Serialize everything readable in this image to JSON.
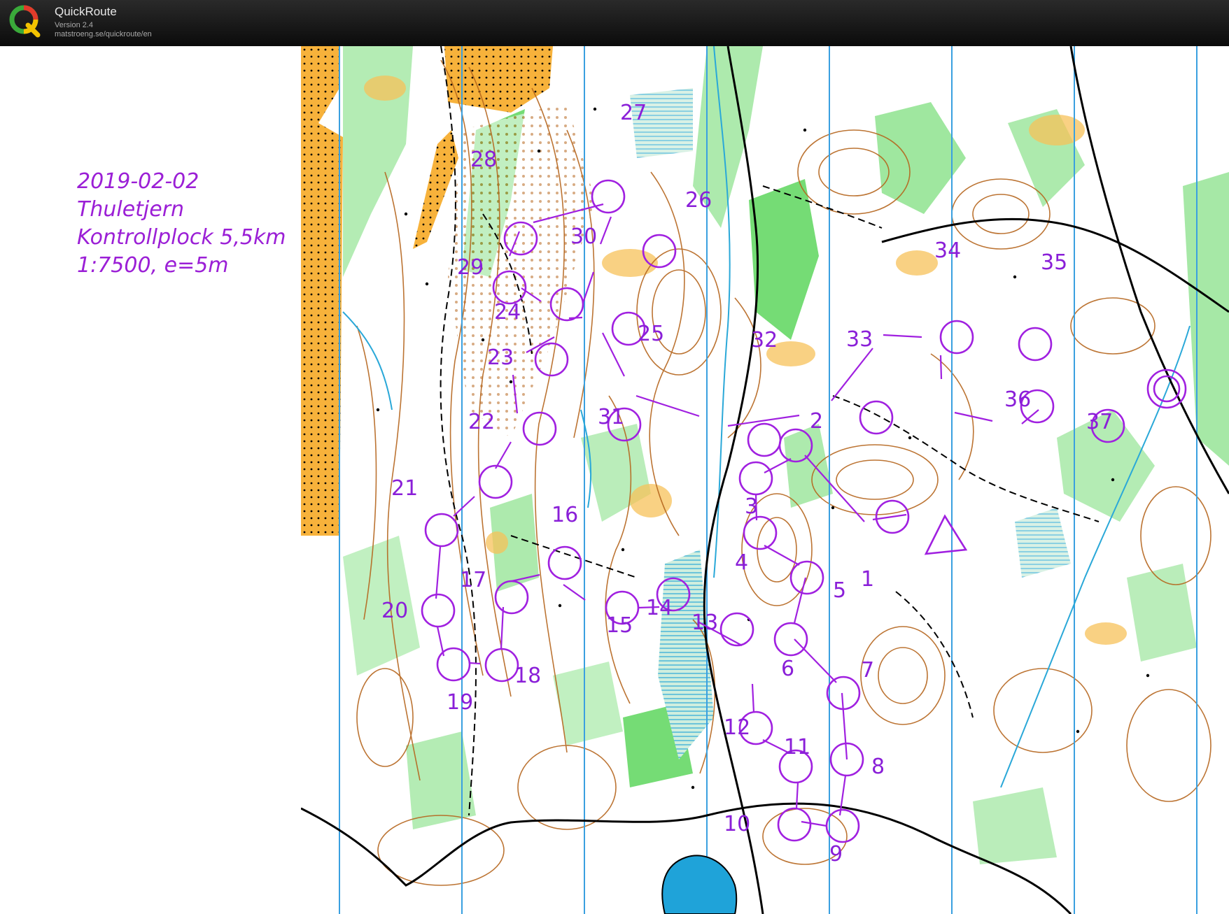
{
  "app": {
    "name": "QuickRoute",
    "version": "Version 2.4",
    "url": "matstroeng.se/quickroute/en"
  },
  "event": {
    "date": "2019-02-02",
    "place": "Thuletjern",
    "course": "Kontrollplock 5,5km",
    "scale": "1:7500, e=5m"
  },
  "colors": {
    "course": "#a020e0",
    "forest": "#ffffff",
    "green": "#5dd65d",
    "open": "#f7b23b",
    "contour": "#b5651d",
    "water": "#2aa8d8",
    "magnetic_north": "#3aa0e0"
  },
  "controls": [
    {
      "label": "1"
    },
    {
      "label": "2"
    },
    {
      "label": "3"
    },
    {
      "label": "4"
    },
    {
      "label": "5"
    },
    {
      "label": "6"
    },
    {
      "label": "7"
    },
    {
      "label": "8"
    },
    {
      "label": "9"
    },
    {
      "label": "10"
    },
    {
      "label": "11"
    },
    {
      "label": "12"
    },
    {
      "label": "13"
    },
    {
      "label": "14"
    },
    {
      "label": "15"
    },
    {
      "label": "16"
    },
    {
      "label": "17"
    },
    {
      "label": "18"
    },
    {
      "label": "19"
    },
    {
      "label": "20"
    },
    {
      "label": "21"
    },
    {
      "label": "22"
    },
    {
      "label": "23"
    },
    {
      "label": "24"
    },
    {
      "label": "25"
    },
    {
      "label": "26"
    },
    {
      "label": "27"
    },
    {
      "label": "28"
    },
    {
      "label": "29"
    },
    {
      "label": "30"
    },
    {
      "label": "31"
    },
    {
      "label": "32"
    },
    {
      "label": "33"
    },
    {
      "label": "34"
    },
    {
      "label": "35"
    },
    {
      "label": "36"
    },
    {
      "label": "37"
    }
  ]
}
